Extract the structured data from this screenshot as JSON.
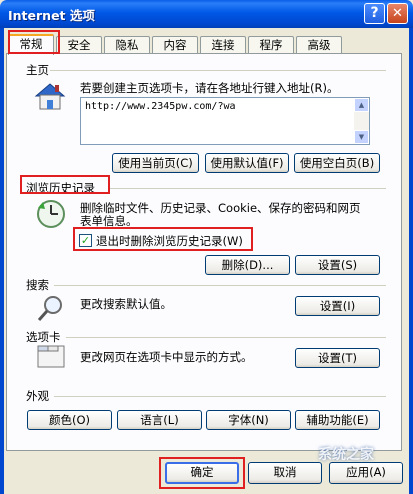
{
  "window": {
    "title": "Internet 选项",
    "help": "?",
    "close": "✕"
  },
  "tabs": [
    "常规",
    "安全",
    "隐私",
    "内容",
    "连接",
    "程序",
    "高级"
  ],
  "home": {
    "label": "主页",
    "desc": "若要创建主页选项卡，请在各地址行键入地址(R)。",
    "address": "http://www.2345pw.com/?wa",
    "buttons": [
      "使用当前页(C)",
      "使用默认值(F)",
      "使用空白页(B)"
    ]
  },
  "history": {
    "label": "浏览历史记录",
    "desc1": "删除临时文件、历史记录、Cookie、保存的密码和网页",
    "desc2": "表单信息。",
    "checkbox_label": "退出时删除浏览历史记录(W)",
    "checkbox_checked": true,
    "delete_button": "删除(D)...",
    "settings_button": "设置(S)"
  },
  "search": {
    "label": "搜索",
    "desc": "更改搜索默认值。",
    "settings_button": "设置(I)"
  },
  "tabs_section": {
    "label": "选项卡",
    "desc": "更改网页在选项卡中显示的方式。",
    "settings_button": "设置(T)"
  },
  "appearance": {
    "label": "外观",
    "buttons": [
      "颜色(O)",
      "语言(L)",
      "字体(N)",
      "辅助功能(E)"
    ]
  },
  "footer": {
    "ok": "确定",
    "cancel": "取消",
    "apply": "应用(A)"
  },
  "watermark": "系统之家",
  "colors": {
    "titlebar": "#0058e6",
    "highlight_box": "#e02020",
    "face": "#ece9d8"
  }
}
